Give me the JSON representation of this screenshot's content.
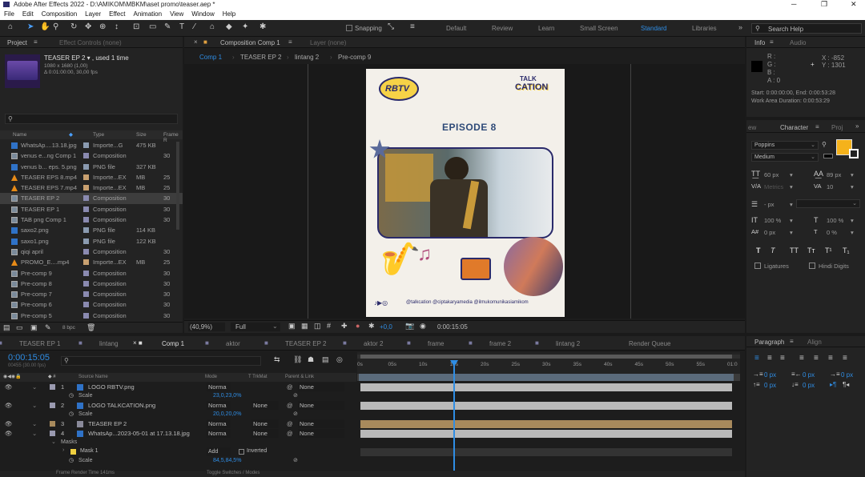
{
  "window": {
    "title": "Adobe After Effects 2022 - D:\\AMIKOM\\MBKM\\aset promo\\teaser.aep *"
  },
  "menu": [
    "File",
    "Edit",
    "Composition",
    "Layer",
    "Effect",
    "Animation",
    "View",
    "Window",
    "Help"
  ],
  "toolbar": {
    "snapping": "Snapping",
    "workspaces": [
      "Default",
      "Review",
      "Learn",
      "Small Screen",
      "Standard",
      "Libraries"
    ],
    "active_workspace": "Standard",
    "search_placeholder": "Search Help"
  },
  "project": {
    "tab": "Project",
    "effect_controls": "Effect Controls (none)",
    "selected_name": "TEASER EP 2 ▾ , used 1 time",
    "selected_size": "1080 x 1680 (1,00)",
    "selected_time": "Δ 0:01:00:00, 30,00 fps",
    "search": "",
    "columns": {
      "name": "Name",
      "type": "Type",
      "size": "Size",
      "frame": "Frame R"
    },
    "items": [
      {
        "name": "WhatsAp....13.18.jpg",
        "type": "Importe...G",
        "size": "475 KB",
        "fr": "",
        "icon": "file"
      },
      {
        "name": "venus e...ng Comp 1",
        "type": "Composition",
        "size": "",
        "fr": "30",
        "icon": "comp"
      },
      {
        "name": "venus b... eps. 5.png",
        "type": "PNG file",
        "size": "327 KB",
        "fr": "",
        "icon": "file"
      },
      {
        "name": "TEASER EPS 8.mp4",
        "type": "Importe...EX",
        "size": "MB",
        "fr": "25",
        "icon": "vlc"
      },
      {
        "name": "TEASER EPS 7.mp4",
        "type": "Importe...EX",
        "size": "MB",
        "fr": "25",
        "icon": "vlc"
      },
      {
        "name": "TEASER EP 2",
        "type": "Composition",
        "size": "",
        "fr": "30",
        "icon": "comp"
      },
      {
        "name": "TEASER EP 1",
        "type": "Composition",
        "size": "",
        "fr": "30",
        "icon": "comp"
      },
      {
        "name": "TAB png Comp 1",
        "type": "Composition",
        "size": "",
        "fr": "30",
        "icon": "comp"
      },
      {
        "name": "saxo2.png",
        "type": "PNG file",
        "size": "114 KB",
        "fr": "",
        "icon": "file"
      },
      {
        "name": "saxo1.png",
        "type": "PNG file",
        "size": "122 KB",
        "fr": "",
        "icon": "file"
      },
      {
        "name": "qiqi april",
        "type": "Composition",
        "size": "",
        "fr": "30",
        "icon": "comp"
      },
      {
        "name": "PROMO_E....mp4",
        "type": "Importe...EX",
        "size": "MB",
        "fr": "25",
        "icon": "vlc"
      },
      {
        "name": "Pre-comp 9",
        "type": "Composition",
        "size": "",
        "fr": "30",
        "icon": "comp"
      },
      {
        "name": "Pre-comp 8",
        "type": "Composition",
        "size": "",
        "fr": "30",
        "icon": "comp"
      },
      {
        "name": "Pre-comp 7",
        "type": "Composition",
        "size": "",
        "fr": "30",
        "icon": "comp"
      },
      {
        "name": "Pre-comp 6",
        "type": "Composition",
        "size": "",
        "fr": "30",
        "icon": "comp"
      },
      {
        "name": "Pre-comp 5",
        "type": "Composition",
        "size": "",
        "fr": "30",
        "icon": "comp"
      }
    ],
    "bpc": "8 bpc"
  },
  "composition": {
    "tab": "Composition Comp 1",
    "layer_tab": "Layer (none)",
    "breadcrumbs": [
      "Comp 1",
      "TEASER EP 2",
      "lintang 2",
      "Pre-comp 9"
    ],
    "zoom": "(40,9%)",
    "quality": "Full",
    "exposure": "+0,0",
    "timecode": "0:00:15:05"
  },
  "poster": {
    "logo_left": "RBTV",
    "logo_right_top": "TALK",
    "logo_right_bottom": "CATION",
    "episode": "EPISODE 8",
    "socials": "@talkcation  @ciptakaryamedia  @ilmukomunikasiamikom"
  },
  "info": {
    "tab": "Info",
    "audio_tab": "Audio",
    "rgba": [
      "R :",
      "G :",
      "B :",
      "A : 0"
    ],
    "x": "X : -852",
    "y": "Y : 1301",
    "start": "Start: 0:00:00:00, End: 0:00:53:28",
    "work_area": "Work Area Duration: 0:00:53:29"
  },
  "character": {
    "tab": "Character",
    "font": "Poppins",
    "style": "Medium",
    "size": "60 px",
    "leading": "89 px",
    "kerning": "Metrics",
    "tracking": "10",
    "stroke": "- px",
    "vscale": "100 %",
    "hscale": "100 %",
    "baseline": "0 px",
    "tsume": "0 %",
    "ligatures": "Ligatures",
    "hindi": "Hindi Digits",
    "fill_color": "#f5b21b"
  },
  "paragraph": {
    "tab": "Paragraph",
    "align_tab": "Align",
    "indent_values": [
      "0 px",
      "0 px",
      "0 px",
      "0 px",
      "0 px"
    ]
  },
  "timeline": {
    "tabs": [
      "TEASER EP 1",
      "lintang",
      "Comp 1",
      "aktor",
      "TEASER EP 2",
      "aktor 2",
      "frame",
      "frame 2",
      "lintang 2",
      "Render Queue"
    ],
    "active_tab": "Comp 1",
    "timecode": "0:00:15:05",
    "frames": "00455 (30.00 fps)",
    "columns": {
      "source": "Source Name",
      "mode": "Mode",
      "trkmat": "T TrkMat",
      "parent": "Parent & Link"
    },
    "ruler": [
      "0s",
      "05s",
      "10s",
      "15s",
      "20s",
      "25s",
      "30s",
      "35s",
      "40s",
      "45s",
      "50s",
      "55s",
      "01:0"
    ],
    "layers": [
      {
        "num": "1",
        "name": "LOGO RBTV.png",
        "mode": "Norma",
        "trk": "",
        "parent": "None",
        "prop": "Scale",
        "val": "23,0,23,0%",
        "color": "#b9b9b9"
      },
      {
        "num": "2",
        "name": "LOGO TALKCATION.png",
        "mode": "Norma",
        "trk": "None",
        "parent": "None",
        "prop": "Scale",
        "val": "20,0,20,0%",
        "color": "#b9b9b9"
      },
      {
        "num": "3",
        "name": "TEASER EP 2",
        "mode": "Norma",
        "trk": "None",
        "parent": "None",
        "color": "#a88a5c"
      },
      {
        "num": "4",
        "name": "WhatsAp...2023-05-01 at 17.13.18.jpg",
        "mode": "Norma",
        "trk": "None",
        "parent": "None",
        "color": "#b9b9b9"
      }
    ],
    "masks_label": "Masks",
    "mask1": "Mask 1",
    "mask_mode": "Add",
    "inverted": "Inverted",
    "mask_scale_label": "Scale",
    "mask_scale": "84,5,84,5%",
    "footer": [
      "Frame Render Time 141ms",
      "Toggle Switches / Modes"
    ]
  }
}
